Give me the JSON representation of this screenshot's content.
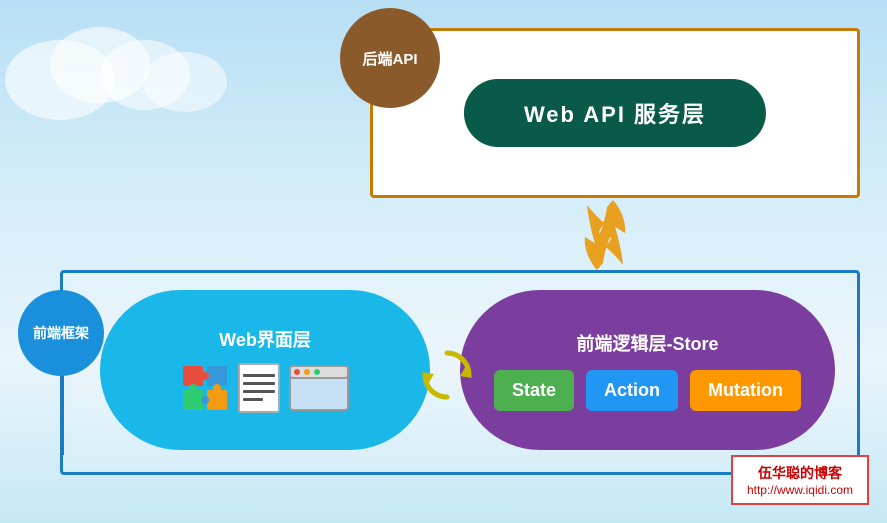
{
  "backend_api": {
    "label": "后端API"
  },
  "web_api_box": {
    "label": "Web  API  服务层"
  },
  "frontend_framework": {
    "label": "前端框架"
  },
  "web_layer": {
    "title": "Web界面层"
  },
  "store_layer": {
    "title": "前端逻辑层-Store",
    "state": "State",
    "action": "Action",
    "mutation": "Mutation"
  },
  "blog": {
    "name": "伍华聪的博客",
    "url": "http://www.iqidi.com"
  }
}
